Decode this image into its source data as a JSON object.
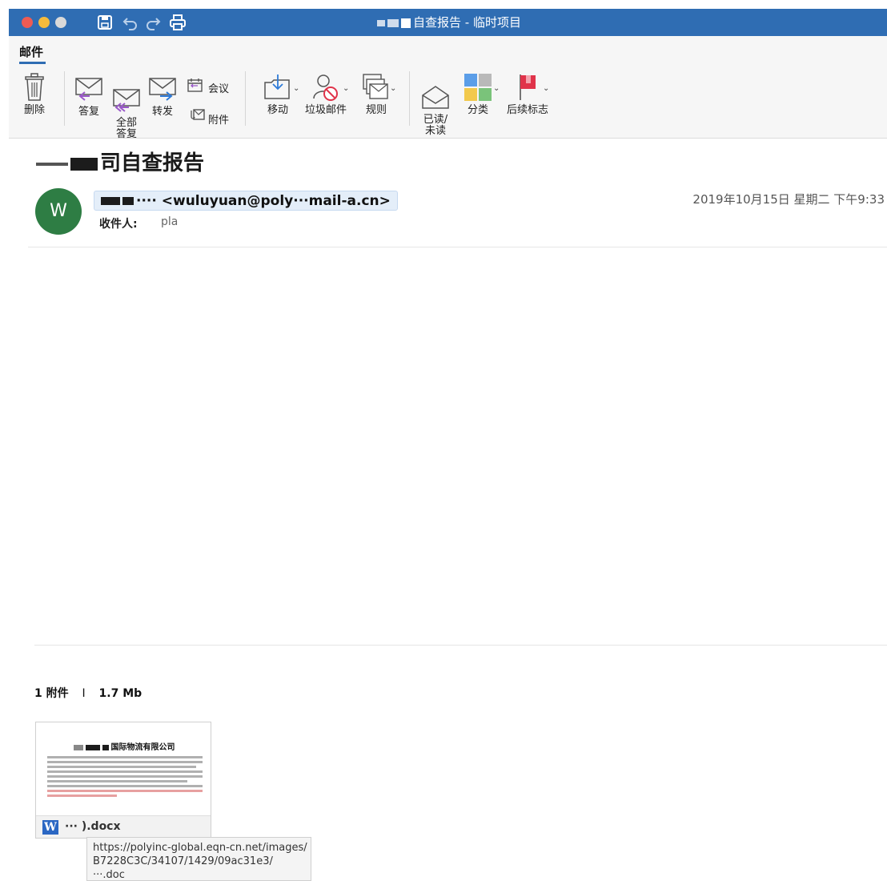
{
  "window": {
    "title": "自查报告 - 临时项目"
  },
  "ribbon": {
    "active_tab": "邮件",
    "buttons": {
      "delete": "删除",
      "reply": "答复",
      "reply_all": "全部\n答复",
      "forward": "转发",
      "meeting": "会议",
      "attachment": "附件",
      "move": "移动",
      "junk": "垃圾邮件",
      "rules": "规则",
      "read_unread": "已读/\n未读",
      "categorize": "分类",
      "follow_up": "后续标志"
    }
  },
  "message": {
    "subject_visible": "司自查报告",
    "sender_visible": "···· <wuluyuan@poly···mail-a.cn>",
    "avatar_letter": "W",
    "date": "2019年10月15日 星期二 下午9:33",
    "to_label": "收件人:",
    "to_value": "pla"
  },
  "attachments": {
    "count_label": "1 附件",
    "separator": "I",
    "size": "1.7 Mb",
    "file": {
      "thumb_title": "国际物流有限公司",
      "name_visible": "··· ).docx",
      "app_icon": "word-icon",
      "app_letter": "W"
    },
    "tooltip": {
      "line1": "https://polyinc-global.eqn-cn.net/images/",
      "line2": "B7228C3C/34107/1429/09ac31e3/",
      "line3": "···.doc"
    }
  },
  "colors": {
    "titlebar": "#2f6db3",
    "avatar": "#2e7d44",
    "follow_flag": "#e0334a",
    "word_icon": "#2b67c3"
  }
}
